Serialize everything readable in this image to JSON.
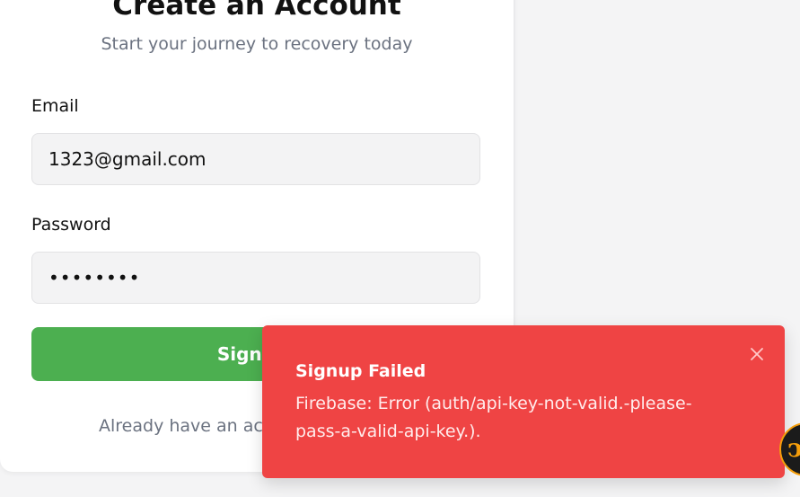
{
  "signup": {
    "title": "Create an Account",
    "subtitle": "Start your journey to recovery today",
    "email_label": "Email",
    "email_value": "1323@gmail.com",
    "password_label": "Password",
    "password_value": "••••••••",
    "submit_label": "Sign Up",
    "footer_text": "Already have an account? Log in"
  },
  "toast": {
    "title": "Signup Failed",
    "message": "Firebase: Error (auth/api-key-not-valid.-please-pass-a-valid-api-key.).",
    "background_color": "#ef4444",
    "close_icon": "close-icon"
  },
  "colors": {
    "primary_button": "#4caf50",
    "error": "#ef4444"
  }
}
